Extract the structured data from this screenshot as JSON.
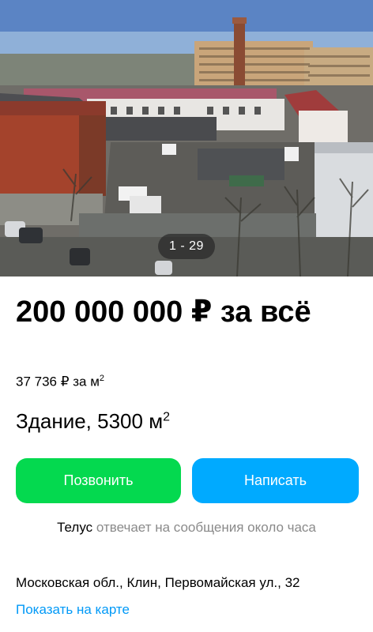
{
  "gallery": {
    "counter": "1 - 29",
    "photo": "aerial-view-of-industrial-building"
  },
  "listing": {
    "price": "200 000 000 ₽ за всё",
    "price_per_m2": "37 736 ₽ за м",
    "price_per_m2_sup": "2",
    "title": "Здание, 5300 м",
    "title_sup": "2"
  },
  "actions": {
    "call_label": "Позвонить",
    "write_label": "Написать"
  },
  "seller": {
    "name": "Телус",
    "reply_text": " отвечает на сообщения около часа"
  },
  "location": {
    "address": "Московская обл., Клин, Первомайская ул., 32",
    "show_on_map": "Показать на карте"
  },
  "colors": {
    "call_button": "#04d94f",
    "write_button": "#00aaff",
    "link": "#0099f7"
  }
}
